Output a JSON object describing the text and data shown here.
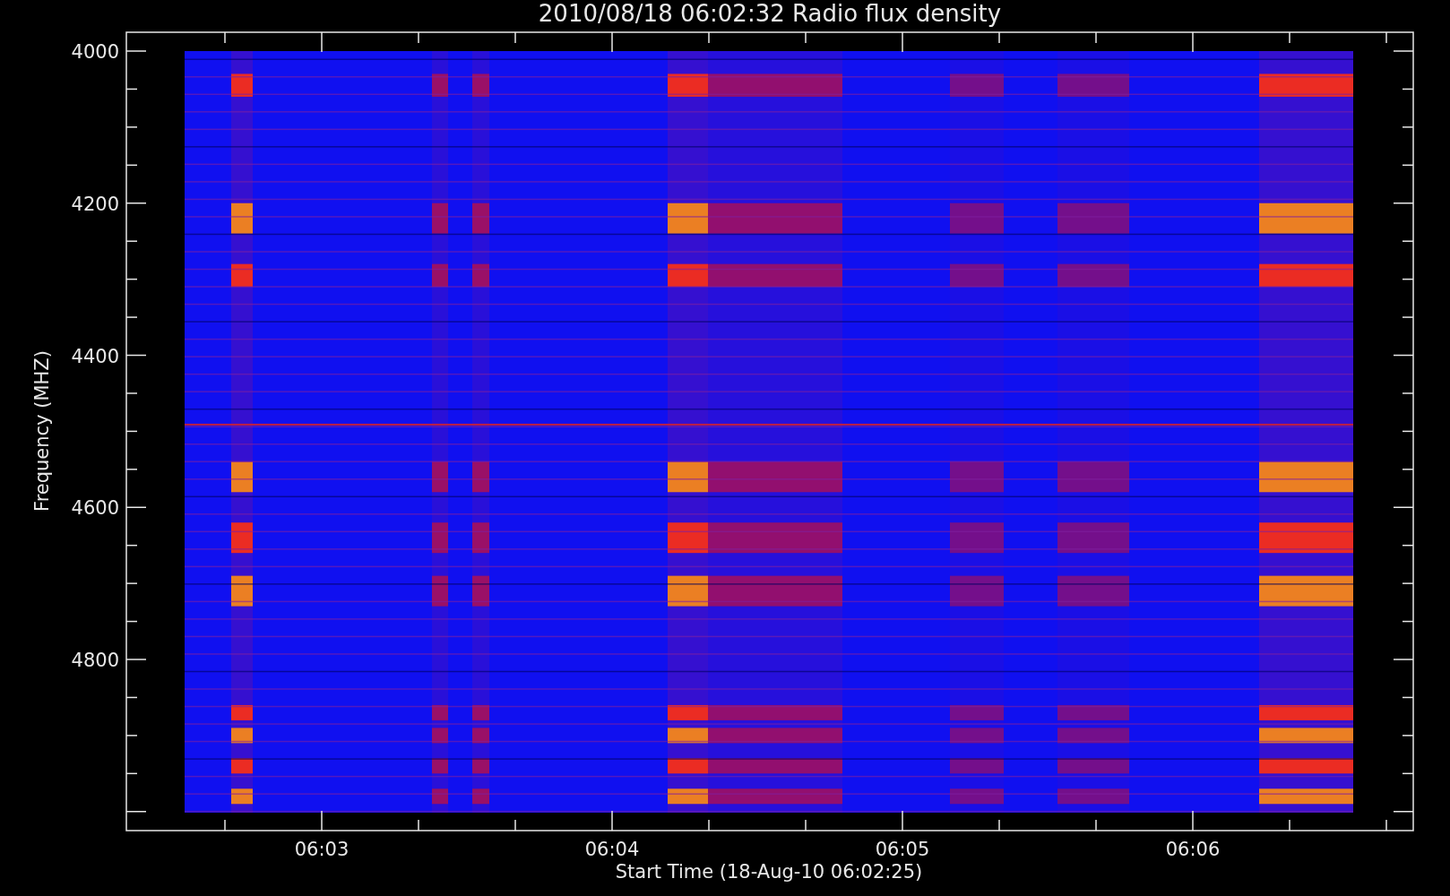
{
  "title": "2010/08/18 06:02:32 Radio flux density",
  "y_axis": {
    "label": "Frequency (MHZ)",
    "ticks": [
      "4000",
      "4200",
      "4400",
      "4600",
      "4800"
    ]
  },
  "x_axis": {
    "label": "Start Time (18-Aug-10 06:02:25)",
    "ticks": [
      "06:03",
      "06:04",
      "06:05",
      "06:06"
    ]
  }
}
